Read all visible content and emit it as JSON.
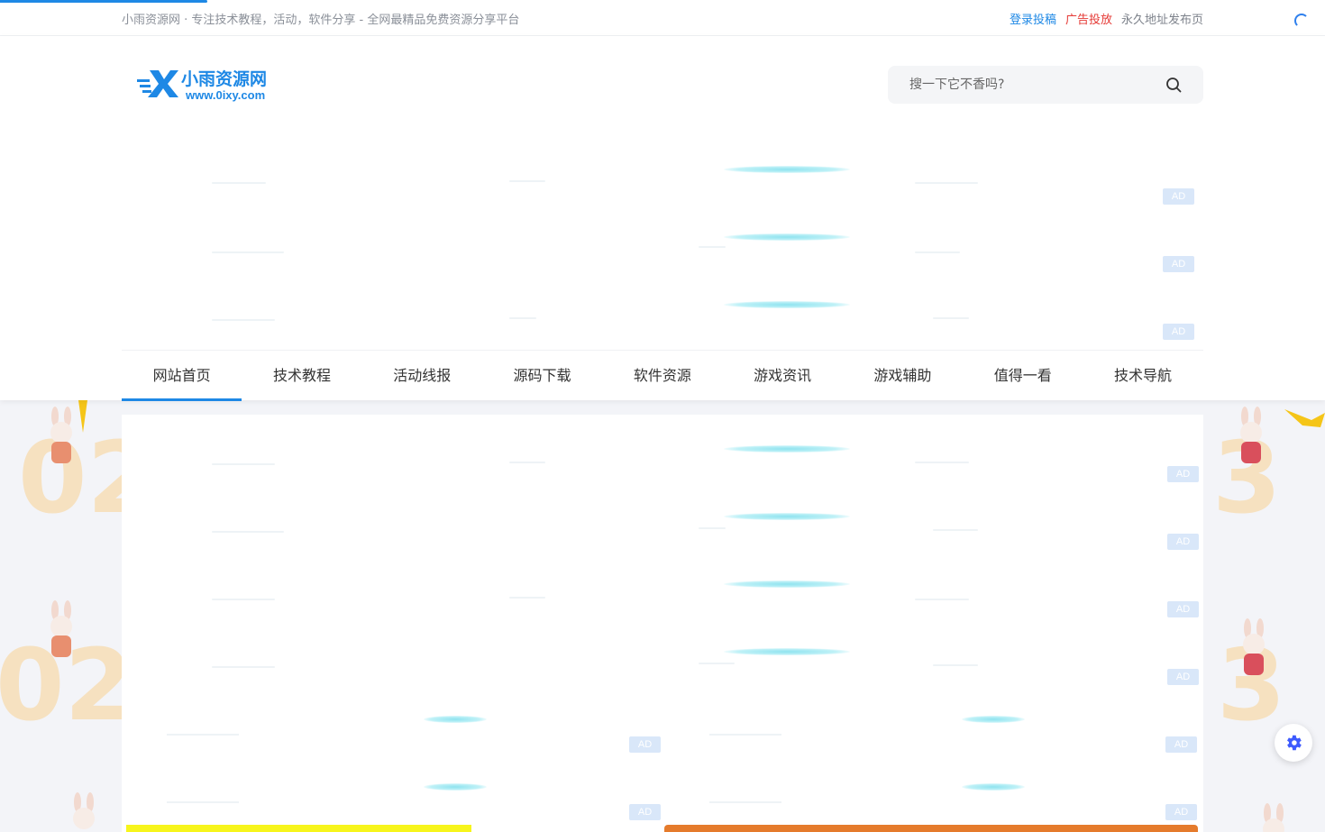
{
  "topbar": {
    "slogan": "小雨资源网 · 专注技术教程，活动，软件分享 - 全网最精品免费资源分享平台",
    "links": {
      "login": "登录投稿",
      "advertise": "广告投放",
      "permanent": "永久地址发布页"
    }
  },
  "logo": {
    "title": "小雨资源网",
    "url": "www.0ixy.com"
  },
  "search": {
    "placeholder": "搜一下它不香吗?"
  },
  "ad_label": "AD",
  "nav": {
    "items": [
      {
        "label": "网站首页",
        "active": true
      },
      {
        "label": "技术教程"
      },
      {
        "label": "活动线报"
      },
      {
        "label": "源码下载"
      },
      {
        "label": "软件资源"
      },
      {
        "label": "游戏资讯"
      },
      {
        "label": "游戏辅助"
      },
      {
        "label": "值得一看"
      },
      {
        "label": "技术导航"
      }
    ]
  },
  "colors": {
    "accent": "#1e88e5",
    "ad_link": "#e53935",
    "ad_badge": "#d9e7f9",
    "banner_yellow": "#f7f51c",
    "banner_orange": "#e57b2c"
  },
  "icons": {
    "search": "search-icon",
    "settings": "gear-icon",
    "loading": "loading-spinner-icon"
  }
}
